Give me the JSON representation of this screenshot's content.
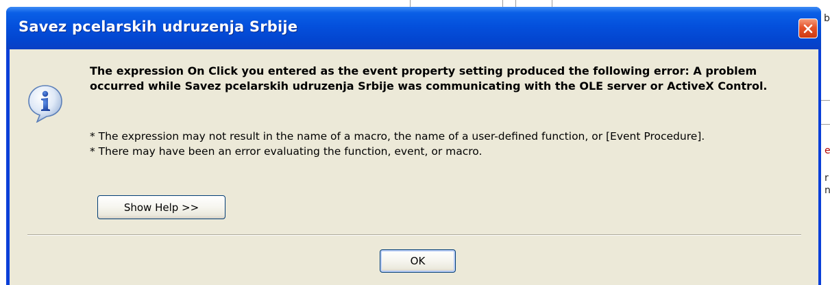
{
  "dialog": {
    "title": "Savez pcelarskih udruzenja Srbije",
    "close_icon": "close-x-icon",
    "message_icon": "info-icon",
    "message_bold": "The expression On Click you entered as the event property setting produced the following error: A problem occurred while Savez pcelarskih udruzenja Srbije was communicating with the OLE server or ActiveX Control.",
    "details": [
      "* The expression may not result in the name of a macro, the name of a user-defined function, or [Event Procedure].",
      "* There may have been an error evaluating the function, event, or macro."
    ],
    "show_help_label": "Show Help >>",
    "ok_label": "OK"
  },
  "background": {
    "fragments": [
      "b",
      "e",
      "r",
      "n"
    ]
  },
  "colors": {
    "titlebar": "#0450dc",
    "client": "#ece9d8",
    "close_button": "#e5532a"
  }
}
